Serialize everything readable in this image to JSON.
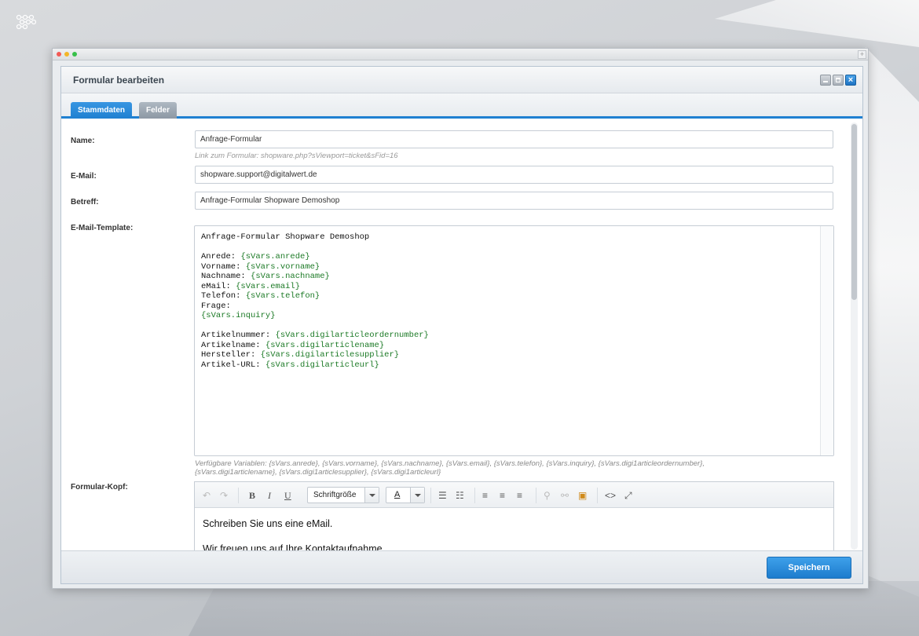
{
  "window": {
    "title": "Formular bearbeiten"
  },
  "tabs": [
    {
      "label": "Stammdaten",
      "active": true
    },
    {
      "label": "Felder",
      "active": false
    }
  ],
  "form": {
    "name": {
      "label": "Name:",
      "value": "Anfrage-Formular",
      "hint": "Link zum Formular: shopware.php?sViewport=ticket&sFid=16"
    },
    "email": {
      "label": "E-Mail:",
      "value": "shopware.support@digitalwert.de"
    },
    "subject": {
      "label": "Betreff:",
      "value": "Anfrage-Formular Shopware Demoshop"
    },
    "template": {
      "label": "E-Mail-Template:",
      "lines": [
        {
          "text": "Anfrage-Formular Shopware Demoshop",
          "var": ""
        },
        {
          "text": "",
          "var": ""
        },
        {
          "text": "Anrede: ",
          "var": "{sVars.anrede}"
        },
        {
          "text": "Vorname: ",
          "var": "{sVars.vorname}"
        },
        {
          "text": "Nachname: ",
          "var": "{sVars.nachname}"
        },
        {
          "text": "eMail: ",
          "var": "{sVars.email}"
        },
        {
          "text": "Telefon: ",
          "var": "{sVars.telefon}"
        },
        {
          "text": "Frage:",
          "var": ""
        },
        {
          "text": "",
          "var": "{sVars.inquiry}"
        },
        {
          "text": "",
          "var": ""
        },
        {
          "text": "Artikelnummer: ",
          "var": "{sVars.digilarticleordernumber}"
        },
        {
          "text": "Artikelname: ",
          "var": "{sVars.digilarticlename}"
        },
        {
          "text": "Hersteller: ",
          "var": "{sVars.digilarticlesupplier}"
        },
        {
          "text": "Artikel-URL: ",
          "var": "{sVars.digilarticleurl}"
        }
      ],
      "hint_line1": "Verfügbare Variablen: {sVars.anrede}, {sVars.vorname}, {sVars.nachname}, {sVars.email}, {sVars.telefon}, {sVars.inquiry}, {sVars.digi1articleordernumber},",
      "hint_line2": "{sVars.digi1articlename}, {sVars.digi1articlesupplier}, {sVars.digi1articleurl}"
    },
    "header": {
      "label": "Formular-Kopf:",
      "toolbar": {
        "font_size_label": "Schriftgröße",
        "color_label": "A"
      },
      "paragraphs": [
        "Schreiben Sie uns eine eMail.",
        "Wir freuen uns auf Ihre Kontaktaufnahme."
      ]
    }
  },
  "footer": {
    "save_label": "Speichern"
  }
}
